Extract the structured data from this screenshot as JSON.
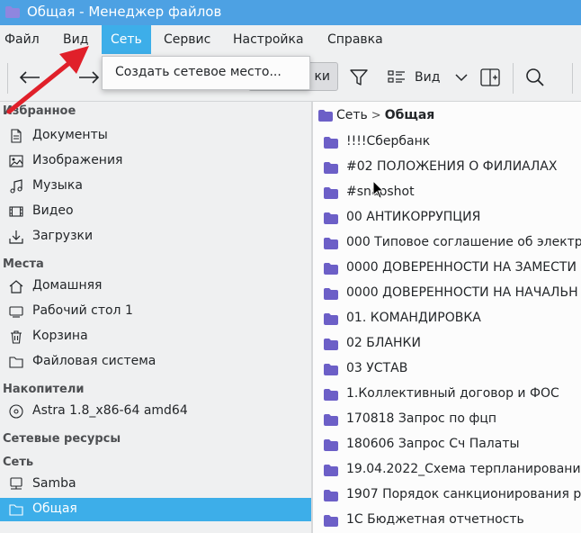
{
  "window": {
    "title": "Общая - Менеджер файлов"
  },
  "menu": {
    "items": [
      {
        "label": "Файл"
      },
      {
        "label": "Вид"
      },
      {
        "label": "Сеть",
        "active": true
      },
      {
        "label": "Сервис"
      },
      {
        "label": "Настройка"
      },
      {
        "label": "Справка"
      }
    ],
    "dropdown": {
      "items": [
        {
          "label": "Создать сетевое место..."
        }
      ]
    }
  },
  "toolbar": {
    "back_icon": "arrow-left-icon",
    "forward_icon": "arrow-right-icon",
    "partial_button_label": "ки",
    "filter_icon": "filter-icon",
    "view_label": "Вид",
    "split_icon": "split-view-icon",
    "search_icon": "search-icon"
  },
  "sidebar": {
    "sections": [
      {
        "title": "Избранное",
        "items": [
          {
            "label": "Документы",
            "icon": "document-icon"
          },
          {
            "label": "Изображения",
            "icon": "image-icon"
          },
          {
            "label": "Музыка",
            "icon": "music-icon"
          },
          {
            "label": "Видео",
            "icon": "video-icon"
          },
          {
            "label": "Загрузки",
            "icon": "download-icon"
          }
        ]
      },
      {
        "title": "Места",
        "items": [
          {
            "label": "Домашняя",
            "icon": "home-icon"
          },
          {
            "label": "Рабочий стол 1",
            "icon": "desktop-icon"
          },
          {
            "label": "Корзина",
            "icon": "trash-icon"
          },
          {
            "label": "Файловая система",
            "icon": "folder-icon"
          }
        ]
      },
      {
        "title": "Накопители",
        "items": [
          {
            "label": "Astra 1.8_x86-64 amd64",
            "icon": "disc-icon"
          }
        ]
      },
      {
        "title": "Сетевые ресурсы",
        "items": []
      },
      {
        "title": "Сеть",
        "items": [
          {
            "label": "Samba",
            "icon": "network-icon"
          },
          {
            "label": "Общая",
            "icon": "folder-icon",
            "selected": true
          }
        ]
      }
    ]
  },
  "breadcrumb": {
    "parent": "Сеть",
    "separator": ">",
    "current": "Общая"
  },
  "files": [
    "!!!!Сбербанк",
    "#02 ПОЛОЖЕНИЯ О ФИЛИАЛАХ",
    "#snapshot",
    "00 АНТИКОРРУПЦИЯ",
    "000 Типовое соглашение об электр",
    "0000 ДОВЕРЕННОСТИ НА ЗАМЕСТИ",
    "0000 ДОВЕРЕННОСТИ НА НАЧАЛЬН",
    "01. КОМАНДИРОВКА",
    "02 БЛАНКИ",
    "03 УСТАВ",
    "1.Коллективный договор и ФОС",
    "170818 Запрос по фцп",
    "180606 Запрос Сч Палаты",
    "19.04.2022_Схема терпланировани",
    "1907 Порядок санкционирования р",
    "1С Бюджетная отчетность"
  ],
  "colors": {
    "accent": "#3daee9",
    "folder": "#6c5fc7",
    "annotation_arrow": "#e0202a"
  }
}
